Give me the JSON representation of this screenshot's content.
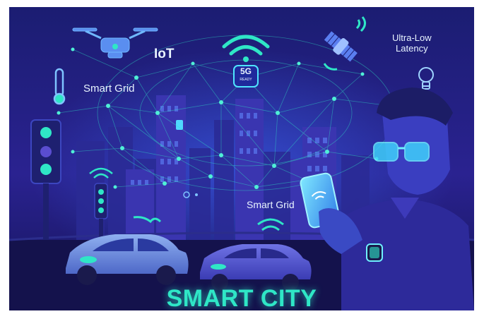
{
  "labels": {
    "iot": "IoT",
    "smart_grid_top": "Smart Grid",
    "smart_grid_mid": "Smart Grid",
    "latency": "Ultra-Low\nLatency",
    "badge_main": "5G",
    "badge_sub": "READY"
  },
  "title": "SMART CITY",
  "colors": {
    "background": "#1a1a66",
    "accent": "#2fe6c6",
    "text": "#e8f4ff"
  },
  "icons": [
    "drone-icon",
    "satellite-icon",
    "thermometer-icon",
    "lightbulb-icon",
    "wifi-icon",
    "traffic-light-icon",
    "car-icon",
    "smartphone-icon",
    "smartwatch-icon",
    "smart-glasses-icon"
  ]
}
